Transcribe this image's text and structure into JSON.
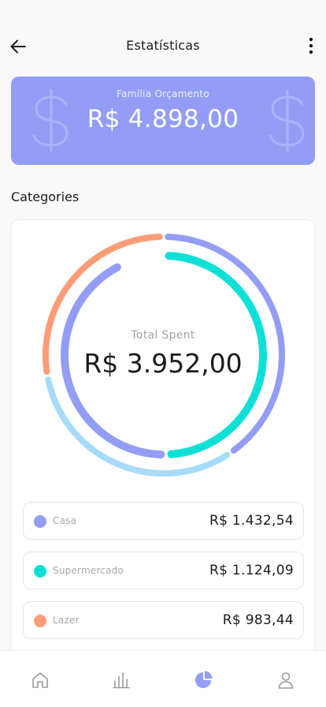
{
  "header": {
    "title": "Estatísticas",
    "back_icon": "arrow-left-icon",
    "more_icon": "more-vertical-icon"
  },
  "budget": {
    "label": "Família Orçamento",
    "amount": "R$ 4.898,00",
    "background_icon": "dollar-sign-icon",
    "color": "#939df6"
  },
  "section_title": "Categories",
  "chart": {
    "total_label": "Total Spent",
    "total_amount": "R$ 3.952,00"
  },
  "chart_data": {
    "type": "donut",
    "total": 3952.0,
    "outer_ring": [
      {
        "color": "#939df6",
        "value": 1432.54
      },
      {
        "color": "#a6dbfb",
        "value": 1124.09
      },
      {
        "color": "#fd9c78",
        "value": 983.44
      }
    ],
    "inner_ring": [
      {
        "color": "#0ee0d7",
        "value": 1124.09
      },
      {
        "color": "#939df6",
        "value": 983.44
      }
    ]
  },
  "categories": [
    {
      "name": "Casa",
      "value": "R$ 1.432,54",
      "color": "#939df6"
    },
    {
      "name": "Supermercado",
      "value": "R$ 1.124,09",
      "color": "#0ee0d7"
    },
    {
      "name": "Lazer",
      "value": "R$ 983,44",
      "color": "#fd9c78"
    }
  ],
  "nav": {
    "items": [
      {
        "icon": "home-icon",
        "active": false
      },
      {
        "icon": "bar-chart-icon",
        "active": false
      },
      {
        "icon": "pie-chart-icon",
        "active": true
      },
      {
        "icon": "user-icon",
        "active": false
      }
    ],
    "active_color": "#939df6",
    "inactive_color": "#9a9a9a"
  }
}
